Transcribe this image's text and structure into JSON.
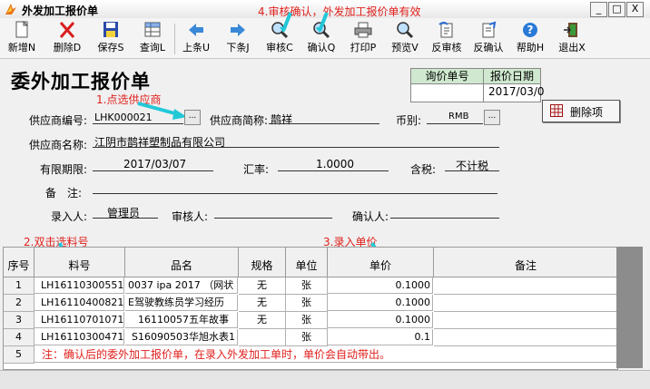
{
  "window": {
    "title": "外发加工报价单",
    "min": "_",
    "max": "□",
    "close": "X"
  },
  "toolbar": [
    {
      "key": "new",
      "label": "新增N",
      "icon": "new-document-icon"
    },
    {
      "key": "delete",
      "label": "删除D",
      "icon": "delete-x-icon"
    },
    {
      "key": "save",
      "label": "保存S",
      "icon": "save-floppy-icon"
    },
    {
      "key": "inquiry",
      "label": "查询L",
      "icon": "query-table-icon"
    },
    {
      "key": "up",
      "label": "上条U",
      "icon": "arrow-left-icon"
    },
    {
      "key": "down",
      "label": "下条J",
      "icon": "arrow-right-icon"
    },
    {
      "key": "audit",
      "label": "审核C",
      "icon": "magnifier-icon"
    },
    {
      "key": "confirm",
      "label": "确认Q",
      "icon": "magnifier-check-icon"
    },
    {
      "key": "print",
      "label": "打印P",
      "icon": "printer-icon"
    },
    {
      "key": "preview",
      "label": "预览V",
      "icon": "magnifier-preview-icon"
    },
    {
      "key": "unaudit",
      "label": "反审核",
      "icon": "undo-audit-icon"
    },
    {
      "key": "unconfirm",
      "label": "反确认",
      "icon": "undo-confirm-icon"
    },
    {
      "key": "help",
      "label": "帮助H",
      "icon": "help-question-icon"
    },
    {
      "key": "exit",
      "label": "退出X",
      "icon": "exit-door-icon"
    }
  ],
  "annotations": {
    "a1": "1.点选供应商",
    "a2": "2.双击选料号",
    "a3": "3.录入单价",
    "a4": "4.审核确认，外发加工报价单有效"
  },
  "form": {
    "title": "委外加工报价单",
    "supplier_code_label": "供应商编号:",
    "supplier_code": "LHK000021",
    "lookup_btn": "...",
    "supplier_short_label": "供应商简称:",
    "supplier_short": "鹊祥",
    "currency_label": "币别:",
    "currency": "RMB",
    "supplier_name_label": "供应商名称:",
    "supplier_name": "江阴市鹊祥塑制品有限公司",
    "valid_until_label": "有限期限:",
    "valid_until": "2017/03/07",
    "rate_label": "汇率:",
    "rate": "1.0000",
    "tax_label": "含税:",
    "tax": "不计税",
    "remark_label": "备　注:",
    "entered_by_label": "录入人:",
    "entered_by": "管理员",
    "auditor_label": "审核人:",
    "confirmer_label": "确认人:",
    "inquiry_no_label": "询价单号",
    "quote_date_label": "报价日期",
    "quote_date": "2017/03/0",
    "delete_item": "删除项"
  },
  "grid": {
    "headers": [
      "序号",
      "料号",
      "品名",
      "规格",
      "单位",
      "单价",
      "备注"
    ],
    "rows": [
      {
        "no": "1",
        "part": "LH16110300551",
        "name": "0037 ipa 2017 （网状",
        "spec": "无",
        "unit": "张",
        "price": "0.1000"
      },
      {
        "no": "2",
        "part": "LH16110400821",
        "name": "E驾驶教练员学习经历",
        "spec": "无",
        "unit": "张",
        "price": "0.1000"
      },
      {
        "no": "3",
        "part": "LH16110701071",
        "name": "16110057五年故事",
        "spec": "无",
        "unit": "张",
        "price": "0.1000"
      },
      {
        "no": "4",
        "part": "LH16110300471",
        "name": "S16090503华旭水表1",
        "spec": "",
        "unit": "张",
        "price": "0.1"
      },
      {
        "no": "5",
        "part": "",
        "name": "",
        "spec": "",
        "unit": "",
        "price": ""
      }
    ],
    "note": "注：确认后的委外加工报价单，在录入外发加工单时，单价会自动带出。"
  }
}
